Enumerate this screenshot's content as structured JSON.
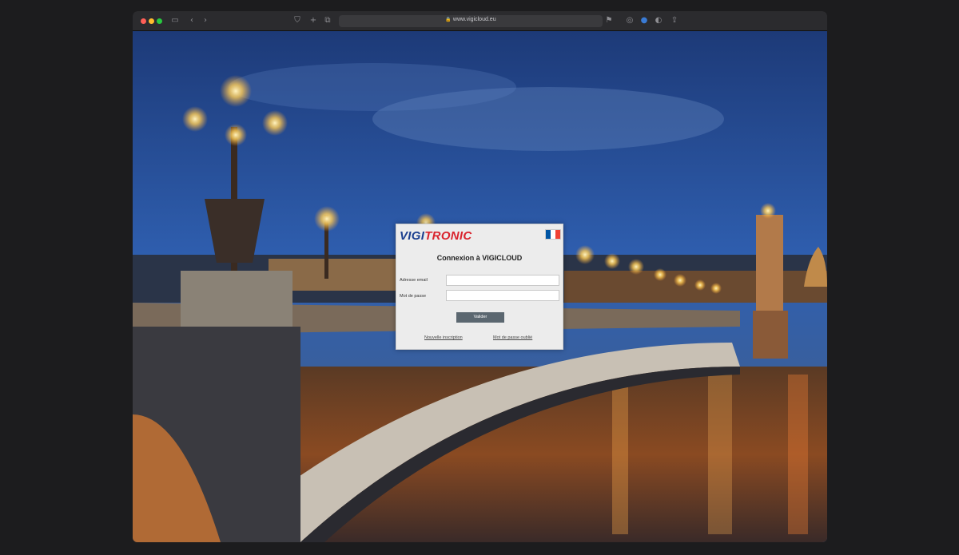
{
  "browser": {
    "url": "www.vigicloud.eu"
  },
  "login": {
    "logo_part1": "VIGI",
    "logo_part2": "TRONIC",
    "title": "Connexion à VIGICLOUD",
    "email_label": "Adresse email",
    "email_value": "",
    "password_label": "Mot de passe",
    "password_value": "",
    "submit_label": "Valider",
    "signup_link": "Nouvelle inscription",
    "forgot_link": "Mot de passe oublié"
  },
  "colors": {
    "logo_blue": "#1b3f8f",
    "logo_red": "#d9232d",
    "button": "#5b6770",
    "flag_blue": "#0055a4",
    "flag_white": "#ffffff",
    "flag_red": "#ef4135"
  }
}
